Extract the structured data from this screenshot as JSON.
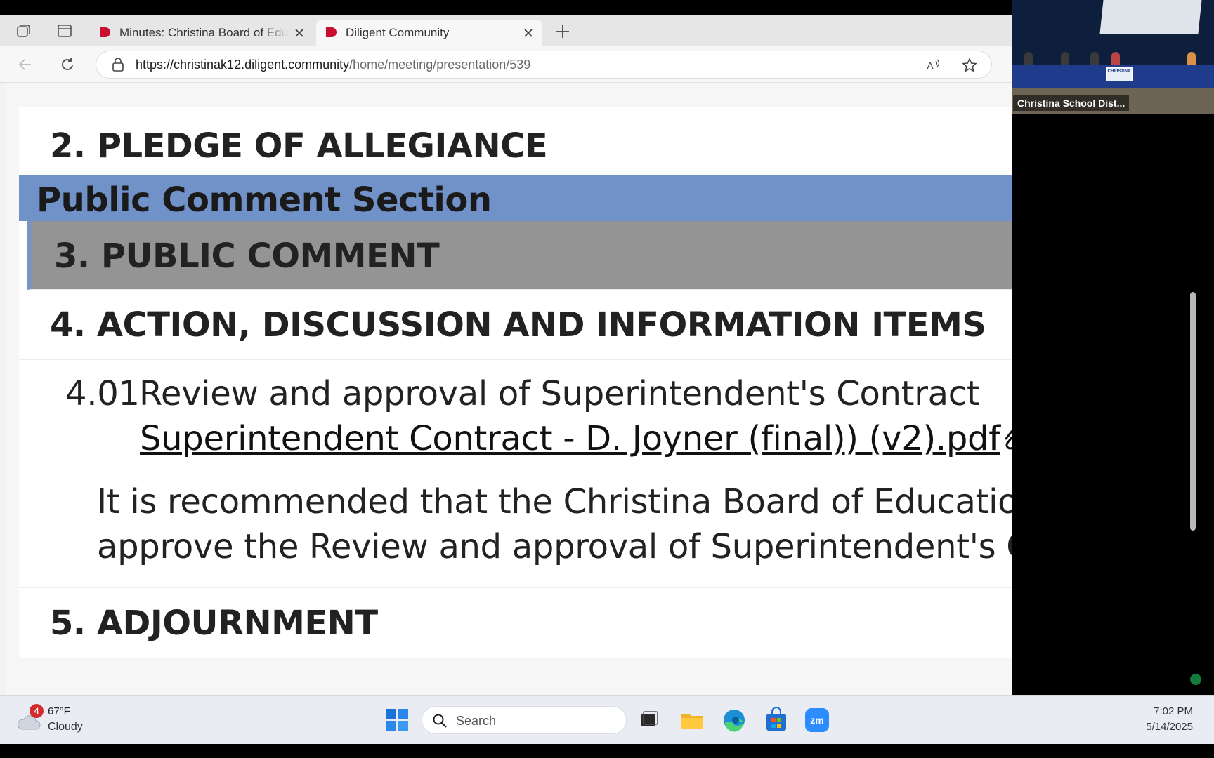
{
  "browser": {
    "tabs": [
      {
        "title": "Minutes: Christina Board of Educa"
      },
      {
        "title": "Diligent Community"
      }
    ],
    "url_host": "https://christinak12.diligent.community",
    "url_path": "/home/meeting/presentation/539"
  },
  "agenda": {
    "pledge_title": "2. PLEDGE OF ALLEGIANCE",
    "section_title": "Public Comment Section",
    "public_comment_title": "3. PUBLIC COMMENT",
    "action_title": "4. ACTION, DISCUSSION AND INFORMATION ITEMS",
    "sub_item": {
      "number": "4.01",
      "title": "Review and approval of Superintendent's Contract",
      "attachment": "Superintendent Contract - D. Joyner (final)) (v2).pdf",
      "recommendation": "It is recommended that the Christina Board of Education approve the Review and approval of Superintendent's Contract"
    },
    "adjourn_title": "5. ADJOURNMENT"
  },
  "zoom_video": {
    "participant_label": "Christina School Dist...",
    "banner_text": "CHRISTINA"
  },
  "taskbar": {
    "weather_badge": "4",
    "temperature": "67°F",
    "condition": "Cloudy",
    "search_placeholder": "Search",
    "time": "7:02 PM",
    "date": "5/14/2025"
  },
  "colors": {
    "section_band": "#7092c8",
    "selected_row": "#949494",
    "diligent_red": "#c8102e",
    "zoom_blue": "#2d8cff"
  }
}
